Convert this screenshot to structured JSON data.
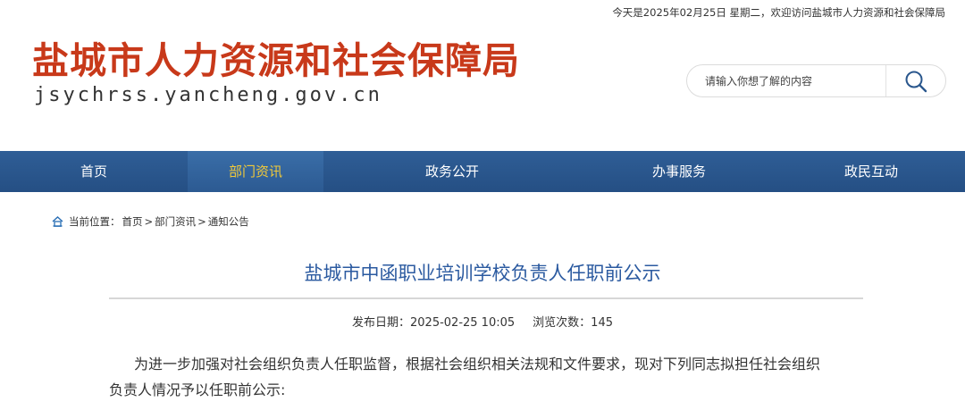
{
  "topbar": {
    "date_text": "今天是2025年02月25日 星期二，欢迎访问盐城市人力资源和社会保障局"
  },
  "header": {
    "site_title": "盐城市人力资源和社会保障局",
    "site_domain": "jsychrss.yancheng.gov.cn",
    "title_color": "#c8391a"
  },
  "search": {
    "placeholder": "请输入你想了解的内容",
    "value": "",
    "icon": "search-icon"
  },
  "nav": {
    "items": [
      {
        "label": "首页",
        "active": false
      },
      {
        "label": "部门资讯",
        "active": true
      },
      {
        "label": "政务公开",
        "active": false
      },
      {
        "label": "办事服务",
        "active": false
      },
      {
        "label": "政民互动",
        "active": false
      }
    ],
    "bar_color": "#2a578d",
    "active_text_color": "#f0c93a"
  },
  "breadcrumb": {
    "icon": "home-icon",
    "prefix": "当前位置：",
    "items": [
      "首页",
      "部门资讯",
      "通知公告"
    ],
    "separator": ">"
  },
  "article": {
    "title": "盐城市中函职业培训学校负责人任职前公示",
    "title_color": "#2b5aa0",
    "publish_label": "发布日期：",
    "publish_date": "2025-02-25 10:05",
    "views_label": "浏览次数：",
    "views": "145",
    "paragraph_line1": "为进一步加强对社会组织负责人任职监督，根据社会组织相关法规和文件要求，现对下列同志拟担任社会组织",
    "paragraph_line2": "负责人情况予以任职前公示:"
  }
}
